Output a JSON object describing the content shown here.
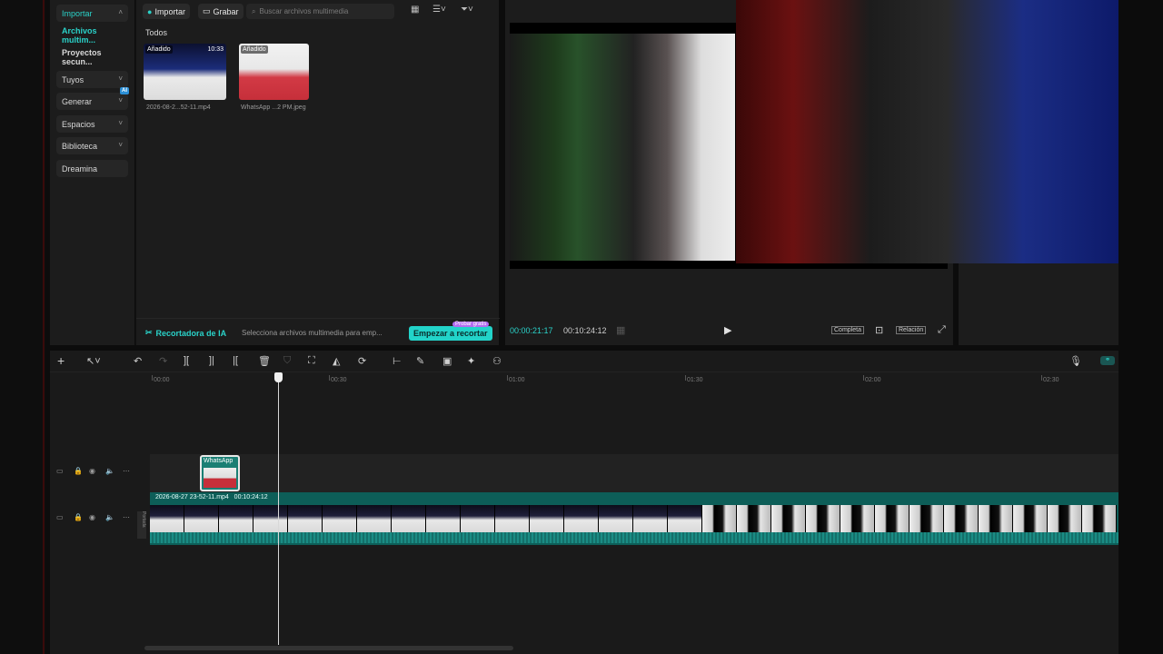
{
  "sidebar": {
    "items": [
      {
        "label": "Importar",
        "chevron": "˄"
      },
      {
        "label": "Archivos multim..."
      },
      {
        "label": "Proyectos secun..."
      },
      {
        "label": "Tuyos",
        "chevron": "˅"
      },
      {
        "label": "Generar",
        "chevron": "˅",
        "badge": "AI"
      },
      {
        "label": "Espacios",
        "chevron": "˅"
      },
      {
        "label": "Biblioteca",
        "chevron": "˅"
      },
      {
        "label": "Dreamina"
      }
    ]
  },
  "media": {
    "import_label": "Importar",
    "record_label": "Grabar",
    "search_placeholder": "Buscar archivos multimedia",
    "section": "Todos",
    "items": [
      {
        "tag": "Añadido",
        "duration": "10:33",
        "name": "2026-08-2...52-11.mp4"
      },
      {
        "tag": "Añadido",
        "name": "WhatsApp ...2 PM.jpeg"
      }
    ],
    "ia": {
      "title": "Recortadora de IA",
      "description": "Selecciona archivos multimedia para emp...",
      "button": "Empezar a recortar",
      "badge": "Probar gratis"
    }
  },
  "player": {
    "current_time": "00:00:21:17",
    "total_time": "00:10:24:12",
    "full_label": "Completa",
    "ratio_label": "Relación"
  },
  "timeline": {
    "ruler": [
      "00:00",
      "00:30",
      "01:00",
      "01:30",
      "02:00",
      "02:30"
    ],
    "overlay_clip_name": "WhatsApp",
    "main_clip_name": "2026-08-27 23-52-11.mp4",
    "main_clip_duration": "00:10:24:12",
    "track_cover_label": "Portada"
  },
  "colors": {
    "accent": "#2ad2c9",
    "clip": "#0d5e58",
    "badge": "#b46cf0"
  }
}
